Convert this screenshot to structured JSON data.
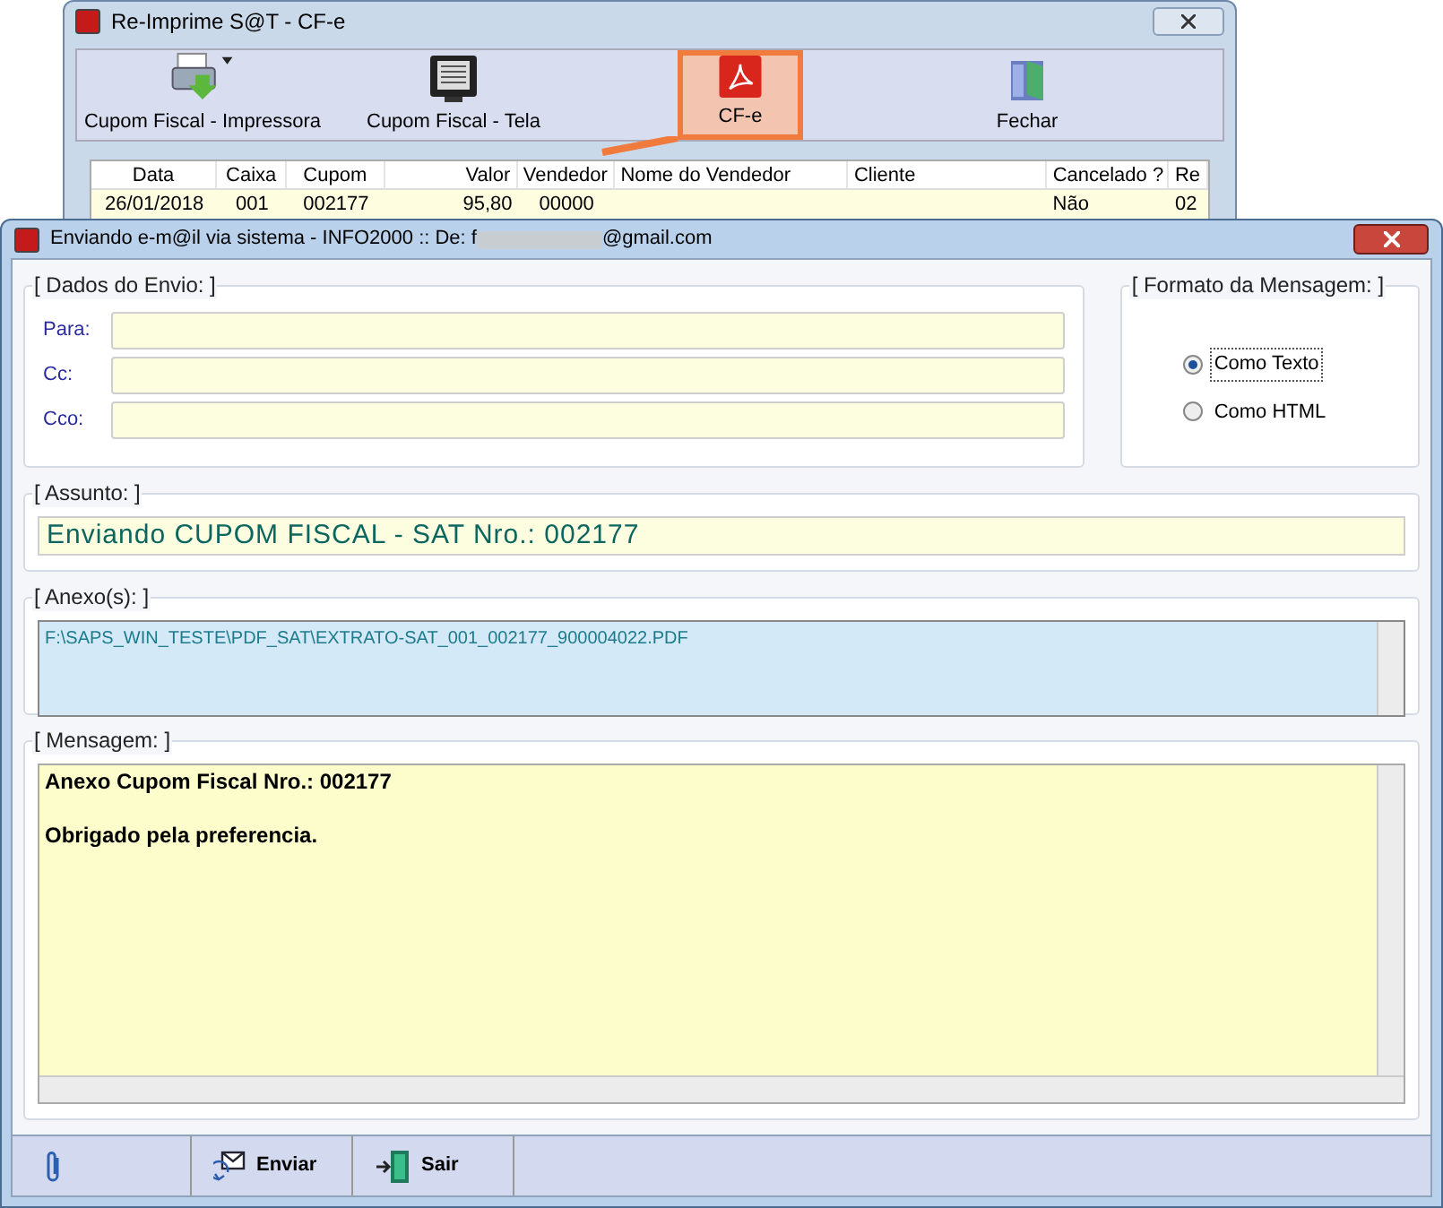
{
  "back_window": {
    "title": "Re-Imprime S@T - CF-e",
    "toolbar": [
      {
        "label": "Cupom Fiscal - Impressora",
        "kind": "printer",
        "selected": false
      },
      {
        "label": "Cupom Fiscal - Tela",
        "kind": "screen",
        "selected": false
      },
      {
        "label": "CF-e",
        "kind": "pdf",
        "selected": true
      },
      {
        "label": "Fechar",
        "kind": "exit",
        "selected": false
      }
    ],
    "table": {
      "columns": [
        "Data",
        "Caixa",
        "Cupom",
        "Valor",
        "Vendedor",
        "Nome do Vendedor",
        "Cliente",
        "Cancelado ?",
        "Re"
      ],
      "rows": [
        [
          "26/01/2018",
          "001",
          "002177",
          "95,80",
          "00000",
          "",
          "",
          "Não",
          "02"
        ]
      ]
    }
  },
  "dialog": {
    "title": "Enviando e-m@il via sistema - INFO2000 :: De: f",
    "title_email": "@gmail.com",
    "send_group": {
      "title": "[ Dados do Envio: ]",
      "fields": [
        {
          "label": "Para:"
        },
        {
          "label": "Cc:"
        },
        {
          "label": "Cco:"
        }
      ]
    },
    "format_group": {
      "title": "[ Formato da Mensagem: ]",
      "options": [
        {
          "label": "Como Texto",
          "selected": true
        },
        {
          "label": "Como HTML",
          "selected": false
        }
      ]
    },
    "subject": {
      "title": "[ Assunto: ]",
      "value": "Enviando CUPOM FISCAL - SAT Nro.: 002177"
    },
    "attachments": {
      "title": "[ Anexo(s): ]",
      "value": "F:\\SAPS_WIN_TESTE\\PDF_SAT\\EXTRATO-SAT_001_002177_900004022.PDF"
    },
    "message": {
      "title": "[ Mensagem: ]",
      "lines": [
        "Anexo Cupom Fiscal Nro.: 002177",
        "Obrigado pela preferencia."
      ]
    },
    "buttons": [
      {
        "label": "Enviar",
        "kind": "send"
      },
      {
        "label": "Sair",
        "kind": "exit"
      }
    ]
  }
}
